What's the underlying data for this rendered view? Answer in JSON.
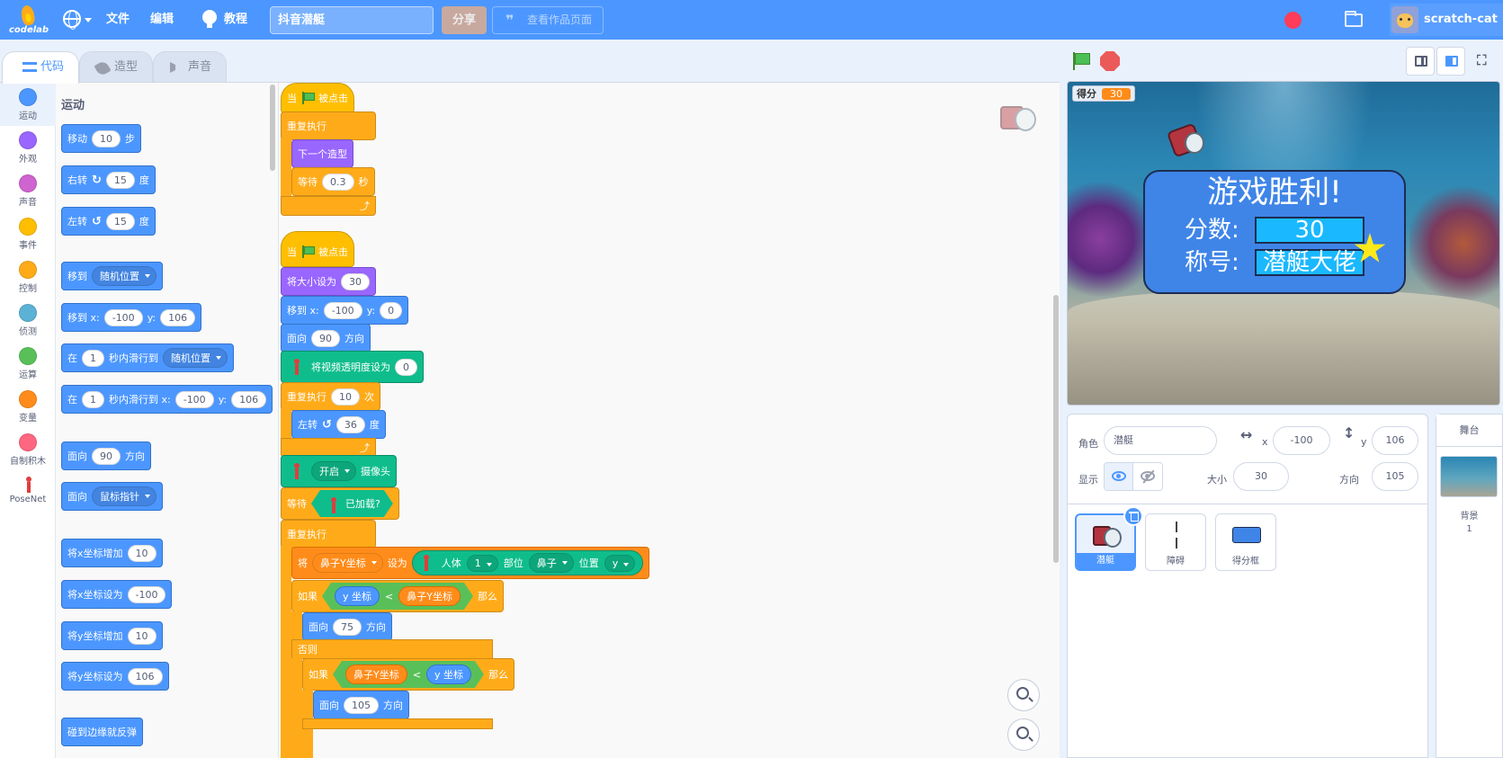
{
  "app": {
    "logo_text": "codelab",
    "menu_file": "文件",
    "menu_edit": "编辑",
    "menu_tutorial": "教程",
    "project_title": "抖音潜艇",
    "share_label": "分享",
    "view_page_label": "查看作品页面",
    "username": "scratch-cat"
  },
  "tabs": {
    "code": "代码",
    "costumes": "造型",
    "sounds": "声音"
  },
  "categories": [
    {
      "label": "运动",
      "color": "#4c97ff"
    },
    {
      "label": "外观",
      "color": "#9966ff"
    },
    {
      "label": "声音",
      "color": "#cf63cf"
    },
    {
      "label": "事件",
      "color": "#ffbf00"
    },
    {
      "label": "控制",
      "color": "#ffab19"
    },
    {
      "label": "侦测",
      "color": "#5cb1d6"
    },
    {
      "label": "运算",
      "color": "#59c059"
    },
    {
      "label": "变量",
      "color": "#ff8c1a"
    },
    {
      "label": "自制积木",
      "color": "#ff6680"
    },
    {
      "label": "PoseNet",
      "color": "#ffffff"
    }
  ],
  "palette": {
    "header": "运动",
    "move": {
      "pre": "移动",
      "val": "10",
      "post": "步"
    },
    "turn_right": {
      "pre": "右转",
      "val": "15",
      "post": "度"
    },
    "turn_left": {
      "pre": "左转",
      "val": "15",
      "post": "度"
    },
    "goto": {
      "pre": "移到",
      "dd": "随机位置"
    },
    "goto_xy": {
      "pre": "移到 x:",
      "x": "-100",
      "ylab": "y:",
      "y": "106"
    },
    "glide": {
      "pre": "在",
      "val": "1",
      "mid": "秒内滑行到",
      "dd": "随机位置"
    },
    "glide_xy": {
      "pre": "在",
      "val": "1",
      "mid": "秒内滑行到 x:",
      "x": "-100",
      "ylab": "y:",
      "y": "106"
    },
    "point_dir": {
      "pre": "面向",
      "val": "90",
      "post": "方向"
    },
    "point_towards": {
      "pre": "面向",
      "dd": "鼠标指针"
    },
    "change_x": {
      "pre": "将x坐标增加",
      "val": "10"
    },
    "set_x": {
      "pre": "将x坐标设为",
      "val": "-100"
    },
    "change_y": {
      "pre": "将y坐标增加",
      "val": "10"
    },
    "set_y": {
      "pre": "将y坐标设为",
      "val": "106"
    },
    "bounce": "碰到边缘就反弹"
  },
  "script1": {
    "hat_pre": "当",
    "hat_post": "被点击",
    "forever": "重复执行",
    "next_costume": "下一个造型",
    "wait_pre": "等待",
    "wait_val": "0.3",
    "wait_post": "秒"
  },
  "script2": {
    "hat_pre": "当",
    "hat_post": "被点击",
    "set_size_pre": "将大小设为",
    "set_size_val": "30",
    "goto_pre": "移到 x:",
    "goto_x": "-100",
    "goto_ylab": "y:",
    "goto_y": "0",
    "face_pre": "面向",
    "face_val": "90",
    "face_post": "方向",
    "video_pre": "将视频透明度设为",
    "video_val": "0",
    "repeat_pre": "重复执行",
    "repeat_val": "10",
    "repeat_post": "次",
    "turn_pre": "左转",
    "turn_val": "36",
    "turn_post": "度",
    "camera_dd": "开启",
    "camera_post": "摄像头",
    "wait_pre": "等待",
    "loaded": "已加载?",
    "forever": "重复执行",
    "set_pre": "将",
    "set_var": "鼻子Y坐标",
    "set_mid": "设为",
    "pose_body": "人体",
    "pose_idx": "1",
    "pose_part_lbl": "部位",
    "pose_part": "鼻子",
    "pose_pos_lbl": "位置",
    "pose_axis": "y",
    "if_pre": "如果",
    "if_ylab": "y 坐标",
    "if_lt": "<",
    "if_var": "鼻子Y坐标",
    "if_then": "那么",
    "face75_pre": "面向",
    "face75_val": "75",
    "face75_post": "方向",
    "else": "否则",
    "if2_pre": "如果",
    "if2_var": "鼻子Y坐标",
    "if2_lt": "<",
    "if2_ylab": "y 坐标",
    "if2_then": "那么",
    "face105_pre": "面向",
    "face105_val": "105",
    "face105_post": "方向"
  },
  "stage": {
    "monitor_label": "得分",
    "monitor_value": "30",
    "win_title": "游戏胜利!",
    "score_label": "分数:",
    "score_value": "30",
    "rank_label": "称号:",
    "rank_value": "潜艇大佬"
  },
  "sprite_info": {
    "sprite_label": "角色",
    "sprite_name": "潜艇",
    "x_label": "x",
    "x_value": "-100",
    "y_label": "y",
    "y_value": "106",
    "show_label": "显示",
    "size_label": "大小",
    "size_value": "30",
    "direction_label": "方向",
    "direction_value": "105"
  },
  "sprites": [
    {
      "name": "潜艇"
    },
    {
      "name": "障碍"
    },
    {
      "name": "得分框"
    }
  ],
  "stage_pane": {
    "header": "舞台",
    "backdrop_label": "背景",
    "backdrop_count": "1"
  }
}
